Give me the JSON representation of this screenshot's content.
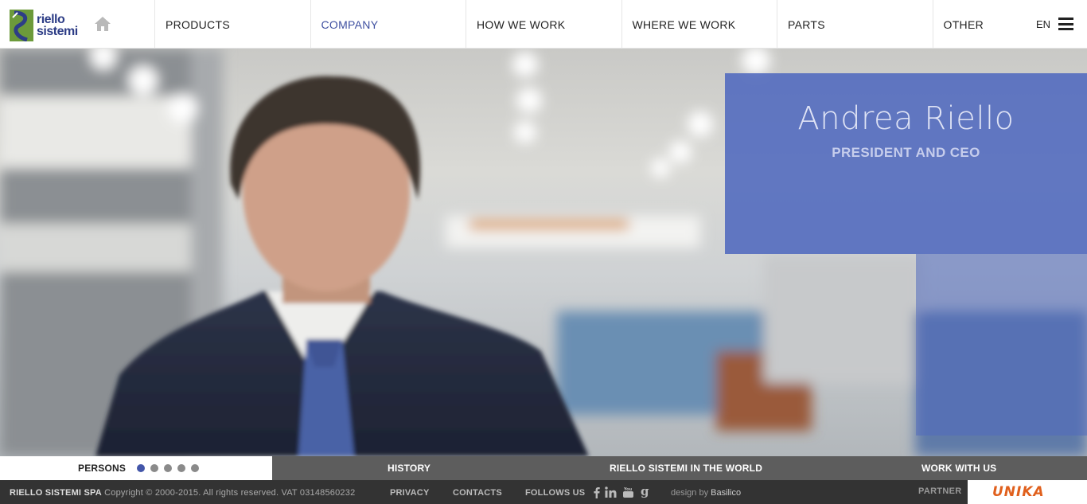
{
  "header": {
    "logo_line1": "riello",
    "logo_line2": "sistemi",
    "nav": [
      {
        "label": "PRODUCTS"
      },
      {
        "label": "COMPANY"
      },
      {
        "label": "HOW WE WORK"
      },
      {
        "label": "WHERE WE WORK"
      },
      {
        "label": "PARTS"
      },
      {
        "label": "OTHER"
      }
    ],
    "active_nav": "COMPANY",
    "language": "EN"
  },
  "hero": {
    "person_name": "Andrea Riello",
    "person_role": "PRESIDENT AND CEO"
  },
  "subnav": {
    "persons": "PERSONS",
    "history": "HISTORY",
    "world": "RIELLO SISTEMI IN THE WORLD",
    "work_with_us": "WORK WITH US",
    "slide_count": 5,
    "active_slide": 1
  },
  "footer": {
    "company": "RIELLO SISTEMI SPA",
    "copyright": "Copyright © 2000-2015. All rights reserved. VAT 03148560232",
    "privacy": "PRIVACY",
    "contacts": "CONTACTS",
    "follow_us": "FOLLOWS US",
    "design_prefix": "design by",
    "designer": "Basilico",
    "partner": "PARTNER",
    "partner_logo": "UNIKA"
  },
  "colors": {
    "brand_blue": "#3e4fa0",
    "info_box": "#5069be",
    "unika_orange": "#e0601d"
  }
}
